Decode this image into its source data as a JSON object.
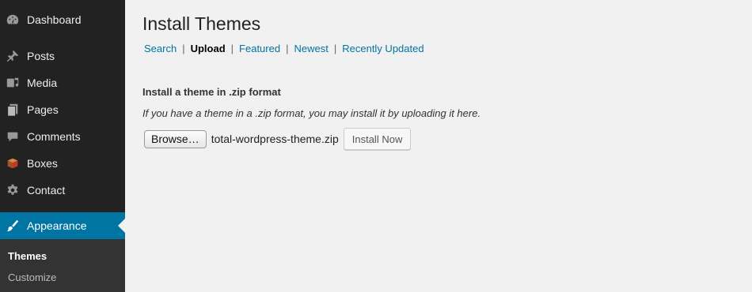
{
  "sidebar": {
    "items": [
      {
        "label": "Dashboard",
        "icon": "dashboard-icon"
      },
      {
        "label": "Posts",
        "icon": "pin-icon"
      },
      {
        "label": "Media",
        "icon": "media-icon"
      },
      {
        "label": "Pages",
        "icon": "pages-icon"
      },
      {
        "label": "Comments",
        "icon": "comment-icon"
      },
      {
        "label": "Boxes",
        "icon": "box-icon"
      },
      {
        "label": "Contact",
        "icon": "gear-icon"
      },
      {
        "label": "Appearance",
        "icon": "brush-icon"
      }
    ],
    "submenu": [
      {
        "label": "Themes"
      },
      {
        "label": "Customize"
      }
    ],
    "active_color": "#0074a2"
  },
  "main": {
    "title": "Install Themes",
    "filters": [
      {
        "label": "Search"
      },
      {
        "label": "Upload"
      },
      {
        "label": "Featured"
      },
      {
        "label": "Newest"
      },
      {
        "label": "Recently Updated"
      }
    ],
    "separator": "|",
    "upload": {
      "heading": "Install a theme in .zip format",
      "hint": "If you have a theme in a .zip format, you may install it by uploading it here.",
      "browse_label": "Browse…",
      "filename": "total-wordpress-theme.zip",
      "install_label": "Install Now"
    }
  }
}
